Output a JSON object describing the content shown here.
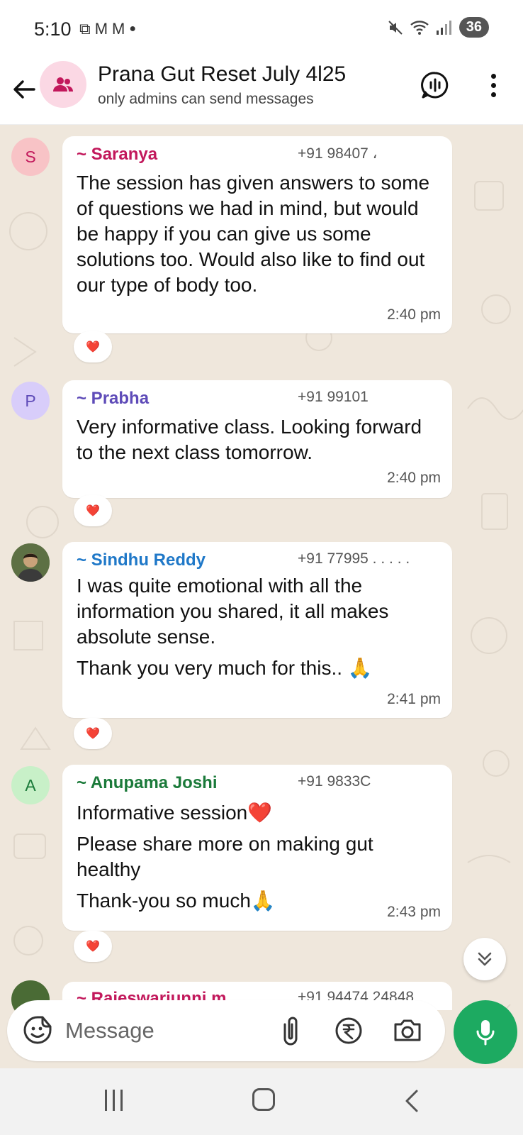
{
  "status_bar": {
    "time": "5:10",
    "battery": "36"
  },
  "header": {
    "title": "Prana Gut Reset July 4l25",
    "subtitle": "only admins can send messages"
  },
  "messages": [
    {
      "avatar_letter": "S",
      "avatar_bg": "#f8c3c6",
      "avatar_fg": "#c2185b",
      "sender": "~ Saranya",
      "sender_color": "#c2185b",
      "phone": "+91 98407 ،",
      "text": "The session has given answers to some of questions we had in mind, but would be happy if you can give us some solutions too. Would also like to find out our type of body too.",
      "time": "2:40 pm",
      "reaction": "❤️"
    },
    {
      "avatar_letter": "P",
      "avatar_bg": "#d8cdfa",
      "avatar_fg": "#5e4bb8",
      "sender": "~ Prabha",
      "sender_color": "#5e4bb8",
      "phone": "+91 99101",
      "text": "Very informative class. Looking forward to the next class tomorrow.",
      "time": "2:40 pm",
      "reaction": "❤️"
    },
    {
      "avatar_letter": "",
      "avatar_bg": "#6b7a4a",
      "avatar_fg": "#ffffff",
      "sender": "~ Sindhu Reddy",
      "sender_color": "#1f78c8",
      "phone": "+91 77995 . . . . .",
      "text": "I was quite emotional with all the information you shared, it all makes absolute sense.",
      "text2": "Thank you very much for this.. 🙏",
      "time": "2:41 pm",
      "reaction": "❤️"
    },
    {
      "avatar_letter": "A",
      "avatar_bg": "#c8f0c8",
      "avatar_fg": "#1b7a3a",
      "sender": "~ Anupama Joshi",
      "sender_color": "#1b7a3a",
      "phone": "+91 9833C",
      "text": "Informative session❤️",
      "text2": "Please share more on making gut healthy",
      "text3": "Thank-you so much🙏",
      "time": "2:43 pm",
      "reaction": "❤️"
    }
  ],
  "partial_message": {
    "sender": "~ Rajeswariunni m",
    "phone": "+91 94474 24848"
  },
  "input": {
    "placeholder": "Message"
  }
}
